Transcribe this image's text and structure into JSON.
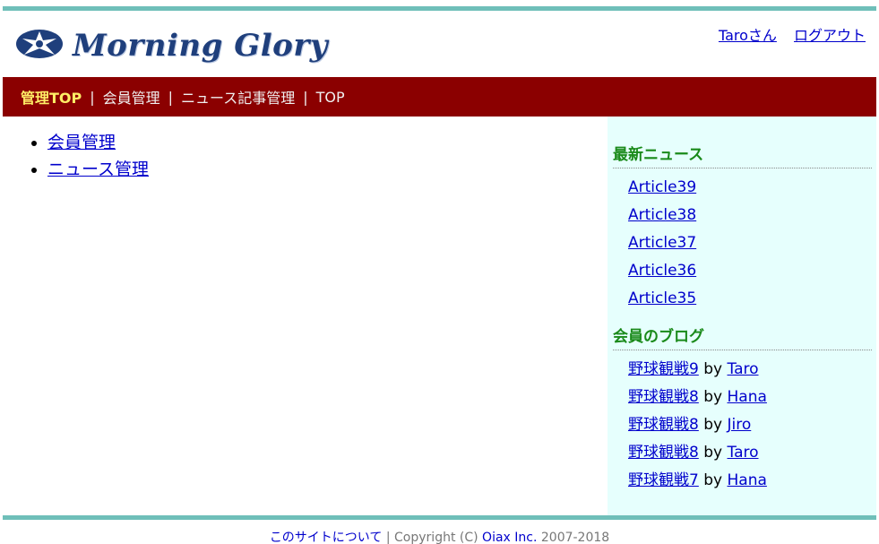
{
  "header": {
    "logo_text": "Morning Glory",
    "user_name_link": "Taroさん",
    "logout_link": "ログアウト"
  },
  "navbar": {
    "items": [
      {
        "label": "管理TOP",
        "active": true
      },
      {
        "label": "会員管理",
        "active": false
      },
      {
        "label": "ニュース記事管理",
        "active": false
      },
      {
        "label": "TOP",
        "active": false
      }
    ],
    "separator": "|"
  },
  "main": {
    "menu": [
      "会員管理",
      "ニュース管理"
    ]
  },
  "sidebar": {
    "news_heading": "最新ニュース",
    "news": [
      "Article39",
      "Article38",
      "Article37",
      "Article36",
      "Article35"
    ],
    "blog_heading": "会員のブログ",
    "blogs": [
      {
        "title": "野球観戦9",
        "by": "by",
        "author": "Taro"
      },
      {
        "title": "野球観戦8",
        "by": "by",
        "author": "Hana"
      },
      {
        "title": "野球観戦8",
        "by": "by",
        "author": "Jiro"
      },
      {
        "title": "野球観戦8",
        "by": "by",
        "author": "Taro"
      },
      {
        "title": "野球観戦7",
        "by": "by",
        "author": "Hana"
      }
    ]
  },
  "footer": {
    "about_link": "このサイトについて",
    "separator": "|",
    "copyright_prefix": "Copyright (C)",
    "company_link": "Oiax Inc.",
    "years": "2007-2018"
  },
  "colors": {
    "navbar_bg": "#8b0000",
    "nav_active": "#ffee66",
    "accent_rule": "#6fbfb9",
    "sidebar_bg": "#e6fffd",
    "sidebar_heading": "#1a8a1a",
    "link": "#0000cc"
  }
}
